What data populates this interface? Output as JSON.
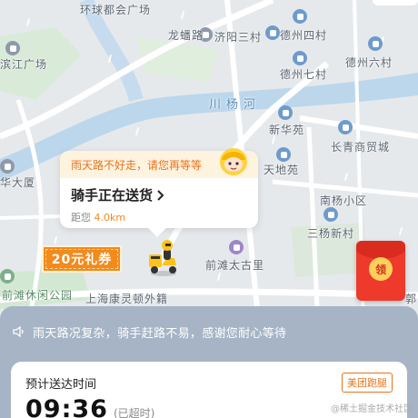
{
  "map": {
    "labels": {
      "huanqiu": "环球都会广场",
      "longpan": "龙蟠路",
      "jiyang": "济阳三村",
      "dezhou4": "德州四村",
      "binjiang": "滨江广场",
      "dezhou7": "德州七村",
      "dezhou6": "德州六村",
      "river": "川杨河",
      "xinhua": "新华苑",
      "changqing": "长青商贸城",
      "tiandi": "天地苑",
      "huada": "华大厦",
      "nanyang": "南杨小区",
      "sanyang": "三杨新村",
      "qiantan_taigu": "前滩太古里",
      "qiantan_park": "前滩休闲公园",
      "kangling": "上海康灵顿外籍",
      "edge_right": "郭"
    }
  },
  "bubble": {
    "notice": "雨天路不好走，请您再等等",
    "title": "骑手正在送货",
    "distance_prefix": "距您",
    "distance_value": "4.0km"
  },
  "coupon": {
    "label": "20元礼券"
  },
  "red_packet": {
    "label": "领"
  },
  "sheet": {
    "notice": "雨天路况复杂，骑手赶路不易，感谢您耐心等待",
    "eta_label": "预计送达时间",
    "eta_time": "09:36",
    "eta_status": "(已超时)",
    "brand": "美团跑腿"
  },
  "watermark": "@稀土掘金技术社区",
  "colors": {
    "accent": "#f08a24",
    "sheet_bg": "#a6b4c6",
    "red_packet": "#ee3a2b"
  }
}
